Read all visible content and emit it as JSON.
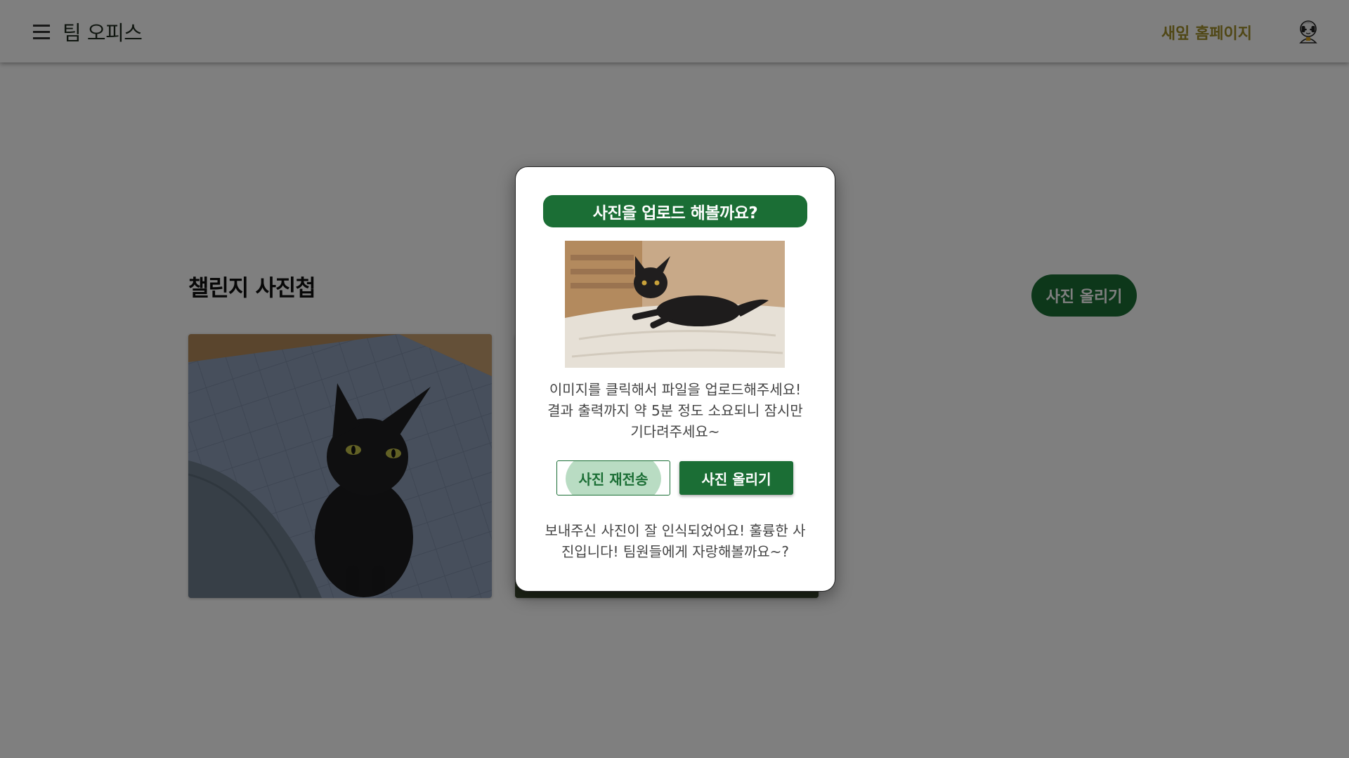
{
  "header": {
    "title": "팀 오피스",
    "nav_link": "새잎 홈페이지",
    "menu_icon": "menu-icon",
    "avatar_icon": "avatar-icon"
  },
  "main": {
    "section_title": "챌린지 사진첩",
    "upload_button": "사진 올리기",
    "cards": [
      {
        "image": "black cat sitting on quilted mat"
      },
      {
        "image": "photo partially hidden"
      }
    ]
  },
  "dialog": {
    "title": "사진을 업로드 해볼까요?",
    "image": "black cat lying on bed",
    "description_lines": [
      "이미지를 클릭해서 파일을 업로드해주세요!",
      "결과 출력까지 약 5분 정도 소요되니 잠시만",
      "기다려주세요~"
    ],
    "resend_button": "사진 재전송",
    "upload_button": "사진 올리기",
    "result_lines": [
      "보내주신 사진이 잘 인식되었어요! 훌륭한 사",
      "진입니다! 팀원들에게 자랑해볼까요~?"
    ]
  },
  "colors": {
    "primary": "#1b6e35",
    "nav_link": "#a08f2b",
    "ripple": "#b9dcc3"
  }
}
